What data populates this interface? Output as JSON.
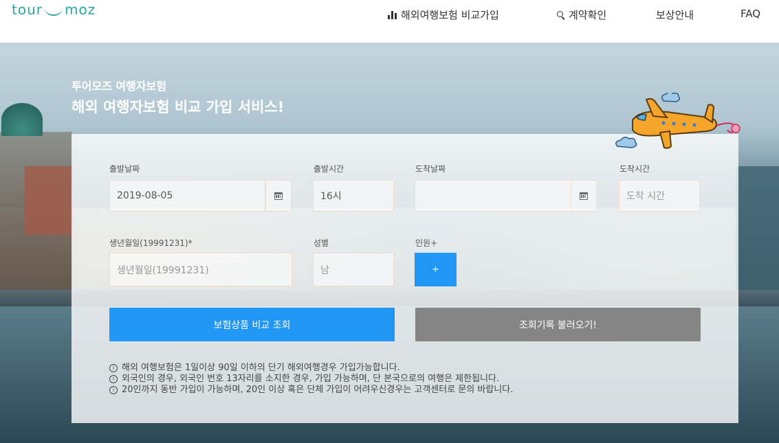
{
  "header": {
    "logo_left": "tour",
    "logo_right": "moz",
    "nav": [
      {
        "label": "해외여행보험 비교가입",
        "icon": "bar-chart-icon"
      },
      {
        "label": "계약확인",
        "icon": "search-icon"
      },
      {
        "label": "보상안내"
      },
      {
        "label": "FAQ"
      }
    ]
  },
  "hero": {
    "subtitle": "투어모즈 여행자보험",
    "title": "해외 여행자보험 비교 가입 서비스!"
  },
  "form": {
    "departure_date": {
      "label": "출발날짜",
      "value": "2019-08-05"
    },
    "departure_time": {
      "label": "출발시간",
      "value": "16시"
    },
    "arrival_date": {
      "label": "도착날짜",
      "value": ""
    },
    "arrival_time": {
      "label": "도착시간",
      "placeholder": "도착 시간"
    },
    "birthdate": {
      "label": "생년월일(19991231)*",
      "placeholder": "생년월일(19991231)"
    },
    "gender": {
      "label": "성별",
      "value": "남"
    },
    "people": {
      "label": "인원+",
      "button": "+"
    }
  },
  "buttons": {
    "compare": "보험상품 비교 조회",
    "load_history": "조회기록 불러오기!"
  },
  "notes": [
    "해외 여행보험은 1일이상 90일 이하의 단기 해외여행경우 가입가능합니다.",
    "외국인의 경우, 외국인 번호 13자리를 소지한 경우, 가입 가능하며, 단 본국으로의 여행은 제한됩니다.",
    "20인까지 동반 가입이 가능하며, 20인 이상 혹은 단체 가입이 어려우신경우는 고객센터로 문의 바랍니다."
  ],
  "colors": {
    "accent": "#2196f3",
    "secondary_button": "#858585",
    "logo": "#2aa7a7",
    "field_border": "#f1dcc9"
  }
}
